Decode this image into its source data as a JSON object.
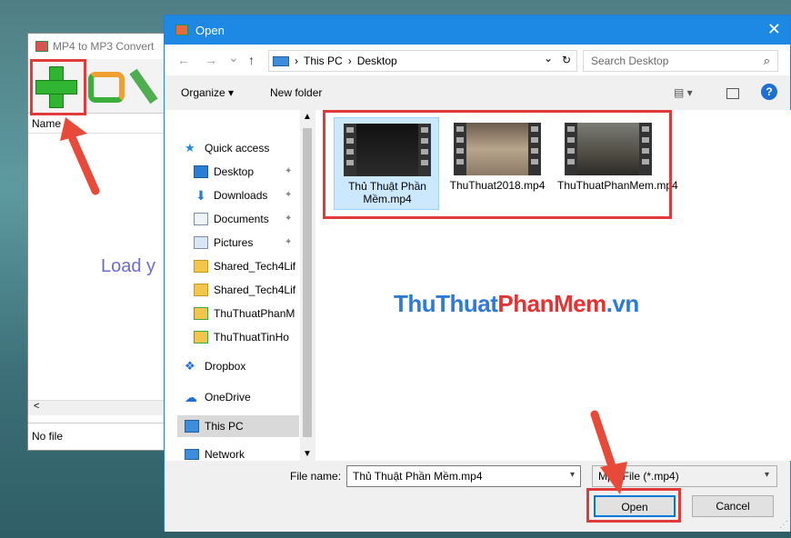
{
  "background_app": {
    "title": "MP4 to MP3 Convert",
    "list_header": "Name",
    "load_text": "Load y",
    "scroll_left": "<",
    "status": "No file"
  },
  "dialog": {
    "title": "Open",
    "close": "✕",
    "nav": {
      "back": "←",
      "forward": "→",
      "recent": "⌄",
      "up": "↑",
      "breadcrumb": [
        "This PC",
        "Desktop"
      ],
      "sep": "›",
      "dropdown": "⌄",
      "refresh": "↻",
      "search_placeholder": "Search Desktop"
    },
    "commands": {
      "organize": "Organize ▾",
      "new_folder": "New folder",
      "view": "▤ ▾",
      "help": "?"
    },
    "nav_pane": [
      {
        "label": "Quick access",
        "icon": "star-icon"
      },
      {
        "label": "Desktop",
        "icon": "desktop-icon",
        "pinned": true
      },
      {
        "label": "Downloads",
        "icon": "download-icon",
        "pinned": true
      },
      {
        "label": "Documents",
        "icon": "document-icon",
        "pinned": true
      },
      {
        "label": "Pictures",
        "icon": "picture-icon",
        "pinned": true
      },
      {
        "label": "Shared_Tech4Lif",
        "icon": "shared-folder-icon"
      },
      {
        "label": "Shared_Tech4Lif",
        "icon": "shared-folder-icon"
      },
      {
        "label": "ThuThuatPhanM",
        "icon": "folder-sync-icon"
      },
      {
        "label": "ThuThuatTinHo",
        "icon": "folder-sync-icon"
      },
      {
        "label": "Dropbox",
        "icon": "dropbox-icon"
      },
      {
        "label": "OneDrive",
        "icon": "onedrive-icon"
      },
      {
        "label": "This PC",
        "icon": "pc-icon",
        "selected": true
      },
      {
        "label": "Network",
        "icon": "network-icon"
      }
    ],
    "files": [
      {
        "name": "Thủ Thuật Phần Mềm.mp4",
        "selected": true,
        "thumb_color": "#1c1c1c"
      },
      {
        "name": "ThuThuat2018.mp4",
        "selected": false,
        "thumb_color": "#8a7a66"
      },
      {
        "name": "ThuThuatPhanMem.mp4",
        "selected": false,
        "thumb_color": "#5d5a4e"
      }
    ],
    "file_labels": [
      "Thủ Thuật Phần Mềm.mp4",
      "ThuThuat2018.mp4",
      "ThuThuatPhanMem.mp4"
    ],
    "watermark": {
      "part1": "ThuThuat",
      "part2": "PhanMem",
      "part3": ".vn"
    },
    "footer": {
      "file_name_label": "File name:",
      "file_name_value": "Thủ Thuật Phần Mềm.mp4",
      "file_type": "Mp4 File (*.mp4)",
      "open": "Open",
      "cancel": "Cancel"
    }
  },
  "colors": {
    "accent": "#1e88e5",
    "highlight_red": "#e03a3a",
    "selection": "#cce8ff"
  }
}
